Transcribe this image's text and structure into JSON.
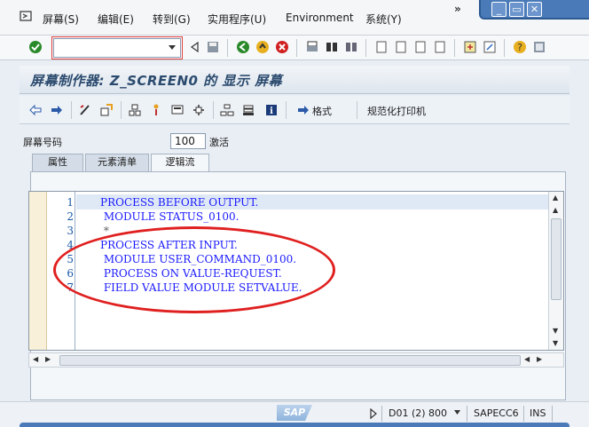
{
  "menu": {
    "items": [
      "屏幕(S)",
      "编辑(E)",
      "转到(G)",
      "实用程序(U)",
      "Environment",
      "系统(Y)"
    ],
    "more": "»"
  },
  "window_controls": {
    "minimize": "_",
    "restore": "▭",
    "close": "✕"
  },
  "title": "屏幕制作器: Z_SCREEN0 的 显示 屏幕",
  "app_toolbar": {
    "format_label": "格式",
    "pretty_print_label": "规范化打印机"
  },
  "screen": {
    "number_label": "屏幕号码",
    "number_value": "100",
    "status": "激活"
  },
  "tabs": [
    "属性",
    "元素清单",
    "逻辑流"
  ],
  "active_tab": "逻辑流",
  "editor": {
    "lines": [
      {
        "num": "1",
        "text": "PROCESS BEFORE OUTPUT."
      },
      {
        "num": "2",
        "text": " MODULE STATUS_0100."
      },
      {
        "num": "3",
        "text": " *"
      },
      {
        "num": "4",
        "text": "PROCESS AFTER INPUT."
      },
      {
        "num": "5",
        "text": " MODULE USER_COMMAND_0100."
      },
      {
        "num": "6",
        "text": " PROCESS ON VALUE-REQUEST."
      },
      {
        "num": "7",
        "text": " FIELD VALUE MODULE SETVALUE."
      }
    ]
  },
  "status_bar": {
    "system": "D01 (2) 800",
    "server": "SAPECC6",
    "mode": "INS",
    "logo": "SAP"
  },
  "colors": {
    "keyword": "#1a1aff",
    "annotation": "#e02020",
    "title": "#2b4a6e"
  }
}
